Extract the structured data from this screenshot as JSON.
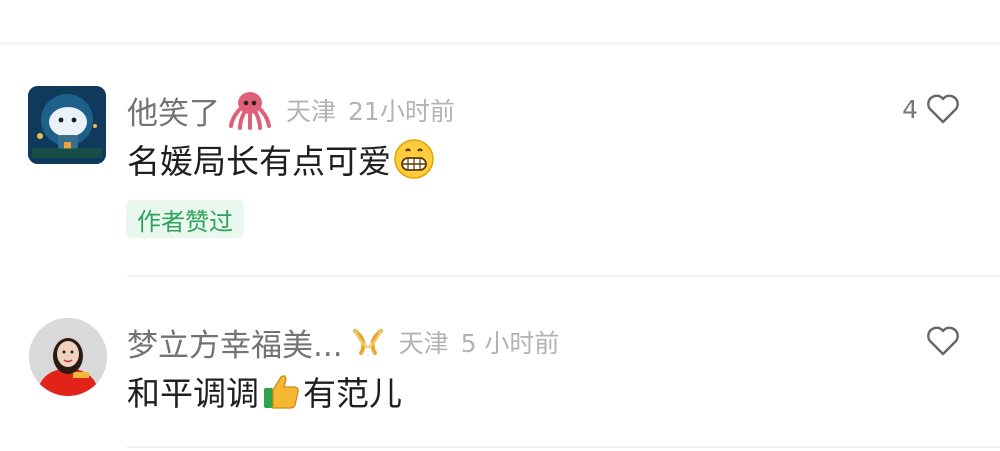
{
  "comments": [
    {
      "username": "他笑了",
      "badge_icon": "octopus-icon",
      "location": "天津",
      "time": "21小时前",
      "text_parts": [
        "名媛局长有点可爱"
      ],
      "emoji": "grinning-face-icon",
      "likes": "4",
      "author_liked": "作者赞过"
    },
    {
      "username": "梦立方幸福美...",
      "badge_icon": "gold-ribbon-icon",
      "location": "天津",
      "time": "5 小时前",
      "text_parts": [
        "和平调调",
        "有范儿"
      ],
      "emoji": "thumbs-up-icon",
      "likes": ""
    }
  ],
  "colors": {
    "name": "#737373",
    "meta": "#b3b3b3",
    "text": "#1f1f1f",
    "liked_bg": "#e9f7ee",
    "liked_text": "#2fa35a"
  }
}
